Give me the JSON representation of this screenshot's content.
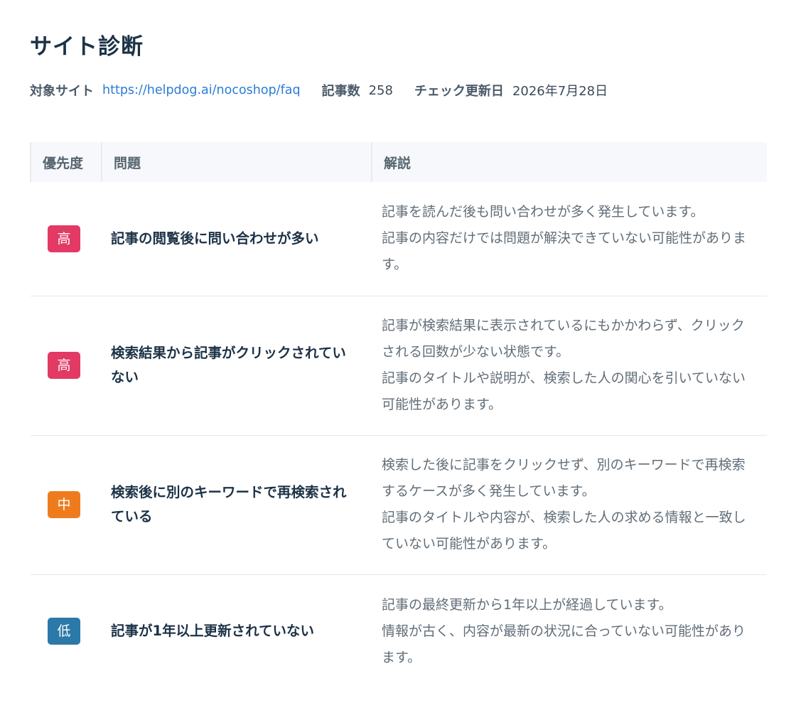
{
  "page": {
    "title": "サイト診断"
  },
  "meta": {
    "site_label": "対象サイト",
    "site_url": "https://helpdog.ai/nocoshop/faq",
    "articles_label": "記事数",
    "articles_count": "258",
    "updated_label": "チェック更新日",
    "updated_date": "2026年7月28日"
  },
  "table": {
    "headers": {
      "priority": "優先度",
      "issue": "問題",
      "description": "解説"
    },
    "rows": [
      {
        "priority": "高",
        "level": "high",
        "issue": "記事の閲覧後に問い合わせが多い",
        "description": [
          "記事を読んだ後も問い合わせが多く発生しています。",
          "記事の内容だけでは問題が解決できていない可能性があります。"
        ]
      },
      {
        "priority": "高",
        "level": "high",
        "issue": "検索結果から記事がクリックされていない",
        "description": [
          "記事が検索結果に表示されているにもかかわらず、クリックされる回数が少ない状態です。",
          "記事のタイトルや説明が、検索した人の関心を引いていない可能性があります。"
        ]
      },
      {
        "priority": "中",
        "level": "mid",
        "issue": "検索後に別のキーワードで再検索されている",
        "description": [
          "検索した後に記事をクリックせず、別のキーワードで再検索するケースが多く発生しています。",
          "記事のタイトルや内容が、検索した人の求める情報と一致していない可能性があります。"
        ]
      },
      {
        "priority": "低",
        "level": "low",
        "issue": "記事が1年以上更新されていない",
        "description": [
          "記事の最終更新から1年以上が経過しています。",
          "情報が古く、内容が最新の状況に合っていない可能性があります。"
        ]
      }
    ]
  },
  "colors": {
    "high": "#e23a64",
    "mid": "#ee7c1e",
    "low": "#2b79a8",
    "link": "#2a7dd6"
  }
}
